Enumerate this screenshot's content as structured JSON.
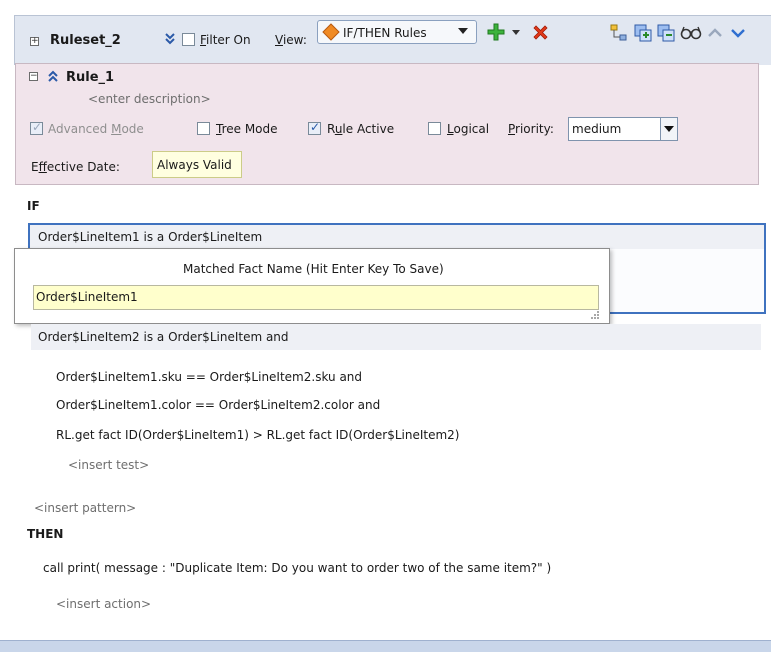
{
  "toolbar": {
    "ruleset_name": "Ruleset_2",
    "filter_label_mnemonic": "F",
    "filter_label_rest": "ilter On",
    "view_label_mnemonic": "V",
    "view_label_rest": "iew:",
    "view_value": "IF/THEN Rules"
  },
  "rule": {
    "name": "Rule_1",
    "description_placeholder": "<enter description>",
    "advanced_mode_label_a": "Advanced ",
    "advanced_mode_label_m": "M",
    "advanced_mode_label_b": "ode",
    "tree_mode_label_t": "T",
    "tree_mode_label_rest": "ree Mode",
    "rule_active_label_a": "R",
    "rule_active_label_u": "u",
    "rule_active_label_b": "le Active",
    "logical_label_l": "L",
    "logical_label_rest": "ogical",
    "priority_label_p": "P",
    "priority_label_rest": "riority:",
    "priority_value": "medium",
    "effective_date_label_a": "E",
    "effective_date_label_f": "f",
    "effective_date_label_b": "fective Date:",
    "effective_date_value": "Always Valid",
    "advanced_mode_checked": true,
    "tree_mode_checked": false,
    "rule_active_checked": true,
    "logical_checked": false
  },
  "if_section": {
    "label": "IF",
    "pattern1": "Order$LineItem1 is a Order$LineItem",
    "pattern2": "Order$LineItem2 is a Order$LineItem  and",
    "tests": [
      "Order$LineItem1.sku  ==  Order$LineItem2.sku and",
      "Order$LineItem1.color  ==  Order$LineItem2.color and",
      "RL.get fact ID(Order$LineItem1)  >  RL.get fact ID(Order$LineItem2)"
    ],
    "insert_test": "<insert test>",
    "insert_pattern": "<insert pattern>"
  },
  "popup": {
    "title": "Matched Fact Name (Hit Enter Key To Save)",
    "value": "Order$LineItem1"
  },
  "then_section": {
    "label": "THEN",
    "action": "call print( message : \"Duplicate Item: Do you want to order two of the same item?\" )",
    "insert_action": "<insert action>"
  },
  "colors": {
    "toolbar_bg": "#e1e7f1",
    "rule_panel_bg": "#f1e4eb",
    "selection_border": "#3f72bf",
    "popup_field_bg": "#ffffcc"
  },
  "icons": [
    "expand-icon",
    "double-chevron-down-icon",
    "diamond-orange-icon",
    "add-green-plus-icon",
    "dropdown-arrow-icon",
    "delete-red-x-icon",
    "tree-icon",
    "copy-icon",
    "paste-icon",
    "glasses-icon",
    "chevron-up-icon",
    "chevron-down-icon",
    "collapse-icon",
    "double-chevron-up-icon"
  ]
}
